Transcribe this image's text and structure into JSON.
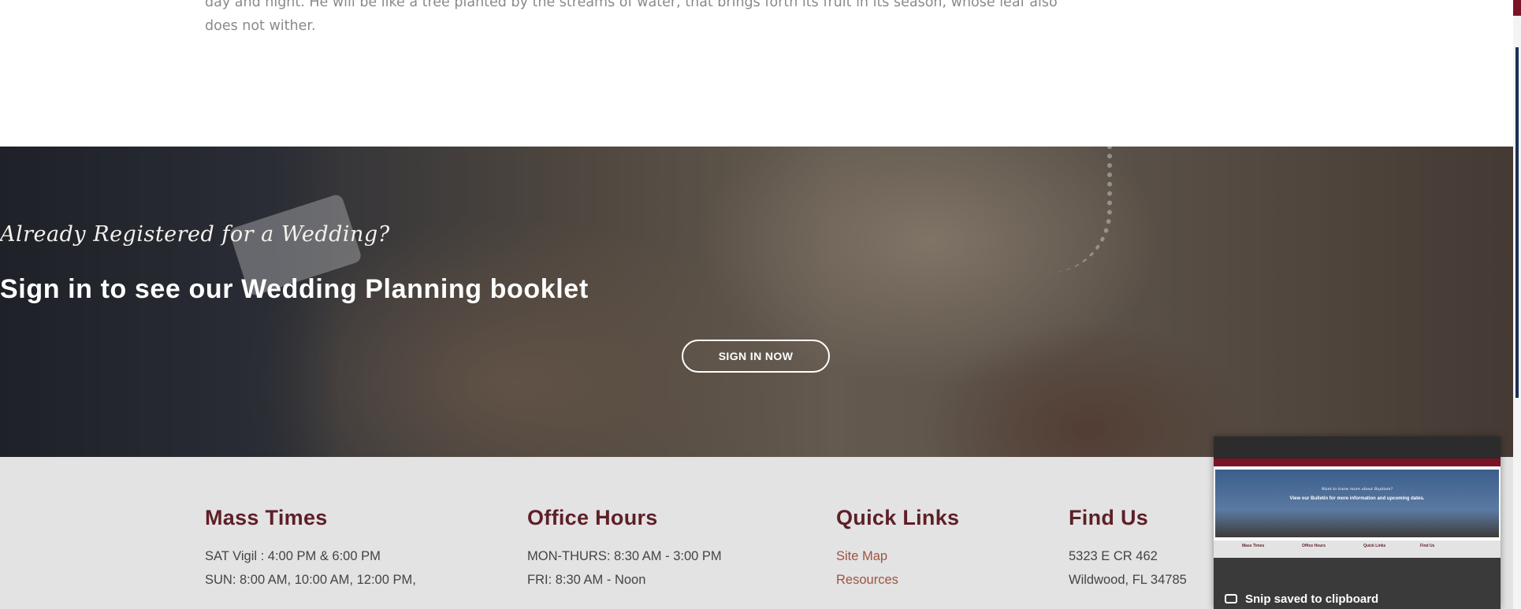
{
  "scripture": {
    "line1": "day and night. He will be like a tree planted by the streams of water, that brings forth its fruit in its season, whose leaf also does not wither."
  },
  "banner": {
    "kicker": "Already Registered for a Wedding?",
    "headline": "Sign in to see our Wedding Planning booklet",
    "button_label": "SIGN IN NOW"
  },
  "footer": {
    "mass_times": {
      "title": "Mass Times",
      "lines": [
        "SAT Vigil : 4:00 PM & 6:00 PM",
        "SUN: 8:00 AM, 10:00 AM, 12:00 PM,"
      ]
    },
    "office_hours": {
      "title": "Office Hours",
      "lines": [
        "MON-THURS: 8:30 AM - 3:00 PM",
        "FRI: 8:30 AM - Noon"
      ]
    },
    "quick_links": {
      "title": "Quick Links",
      "links": [
        "Site Map",
        "Resources"
      ]
    },
    "find_us": {
      "title": "Find Us",
      "lines": [
        "5323 E CR 462",
        "Wildwood, FL 34785"
      ]
    }
  },
  "snip_notification": {
    "message": "Snip saved to clipboard",
    "preview": {
      "hero_kicker": "Want to know more about Baptism?",
      "hero_text": "View our Bulletin for more information and upcoming dates.",
      "footer_labels": [
        "Mass Times",
        "Office Hours",
        "Quick Links",
        "Find Us"
      ]
    }
  },
  "colors": {
    "footer_heading": "#5e1f27",
    "link": "#a0533e",
    "footer_bg": "#e3e3e3"
  }
}
